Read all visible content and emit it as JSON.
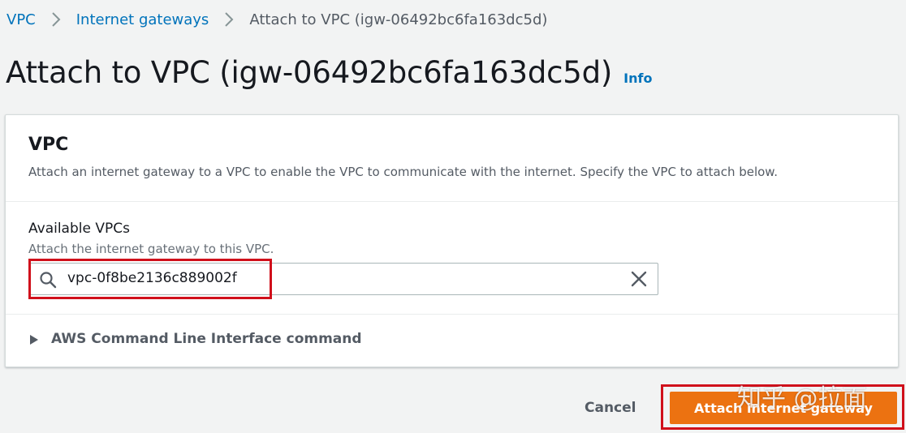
{
  "breadcrumb": {
    "items": [
      "VPC",
      "Internet gateways",
      "Attach to VPC (igw-06492bc6fa163dc5d)"
    ]
  },
  "header": {
    "title": "Attach to VPC (igw-06492bc6fa163dc5d)",
    "info_label": "Info"
  },
  "vpc_section": {
    "title": "VPC",
    "description": "Attach an internet gateway to a VPC to enable the VPC to communicate with the internet. Specify the VPC to attach below.",
    "field_label": "Available VPCs",
    "field_description": "Attach the internet gateway to this VPC.",
    "search_value": "vpc-0f8be2136c889002f",
    "cli_expander_label": "AWS Command Line Interface command"
  },
  "footer": {
    "cancel_label": "Cancel",
    "attach_label": "Attach internet gateway"
  },
  "watermark": "知乎 @拉面",
  "colors": {
    "link": "#0073bb",
    "primary_button": "#ec7211",
    "highlight": "#d0101b",
    "background": "#f2f3f3"
  },
  "icons": {
    "breadcrumb_separator": "chevron-right-icon",
    "search": "search-icon",
    "clear": "close-icon",
    "expander": "caret-right-icon"
  }
}
